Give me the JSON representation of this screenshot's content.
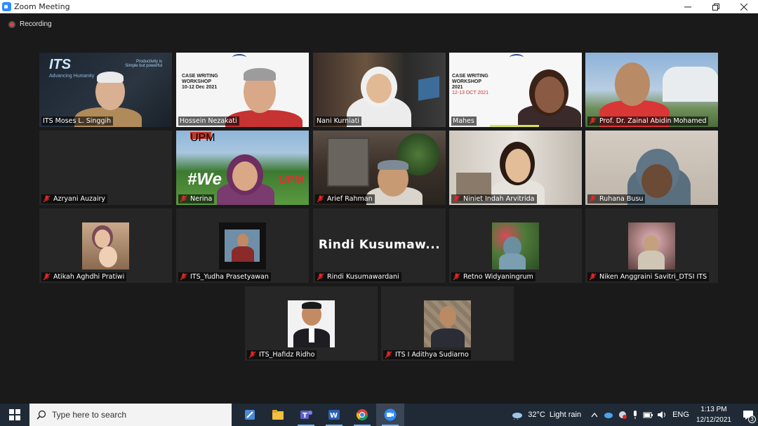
{
  "window": {
    "title": "Zoom Meeting"
  },
  "meeting": {
    "recording_label": "Recording"
  },
  "participants": [
    {
      "name": "ITS Moses L. Singgih",
      "muted": false,
      "active_speaker": true
    },
    {
      "name": "Hossein Nezakati",
      "muted": false
    },
    {
      "name": "Nani Kurniati",
      "muted": false
    },
    {
      "name": "Mahes",
      "muted": false
    },
    {
      "name": "Prof. Dr. Zainal Abidin Mohamed",
      "muted": true
    },
    {
      "name": "Azryani Auzairy",
      "muted": true
    },
    {
      "name": "Nerina",
      "muted": true
    },
    {
      "name": "Arief Rahman",
      "muted": true
    },
    {
      "name": "Niniet Indah Arvitrida",
      "muted": true
    },
    {
      "name": "Ruhana Busu",
      "muted": true
    },
    {
      "name": "Atikah Aghdhi Pratiwi",
      "muted": true
    },
    {
      "name": "ITS_Yudha Prasetyawan",
      "muted": true
    },
    {
      "name": "Rindi Kusumawardani",
      "display": "Rindi  Kusumaw...",
      "muted": true
    },
    {
      "name": "Retno Widyaningrum",
      "muted": true
    },
    {
      "name": "Niken Anggraini Savitri_DTSI ITS",
      "muted": true
    },
    {
      "name": "ITS_Hafidz Ridho",
      "muted": true
    },
    {
      "name": "ITS I Adithya Sudiarno",
      "muted": true
    }
  ],
  "slides": {
    "its_logo": "ITS",
    "its_tagline": "Advancing Humanity",
    "its_slogan_1": "Productivity is",
    "its_slogan_2": "Simple but powerful",
    "case_title_1": "CASE WRITING",
    "case_title_2": "WORKSHOP",
    "case_dates_1": "10-12 Dec 2021",
    "case_dates_2": "2021",
    "case_dates_3": "12-13 OCT 2021",
    "upm": "UPM",
    "welcome": "#We"
  },
  "taskbar": {
    "search_placeholder": "Type here to search",
    "weather_temp": "32°C",
    "weather_desc": "Light rain",
    "language": "ENG",
    "time": "1:13 PM",
    "date": "12/12/2021",
    "notification_count": "3"
  },
  "colors": {
    "active_speaker_border": "#d6e25c",
    "muted_icon": "#e02828",
    "taskbar_bg": "#1f2a36"
  }
}
